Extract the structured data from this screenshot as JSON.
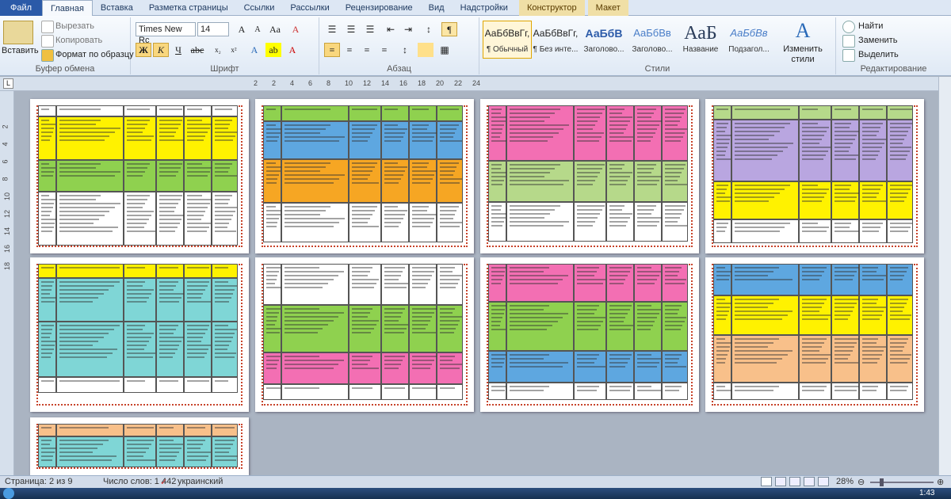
{
  "tabs": [
    "Файл",
    "Главная",
    "Вставка",
    "Разметка страницы",
    "Ссылки",
    "Рассылки",
    "Рецензирование",
    "Вид",
    "Надстройки",
    "Конструктор",
    "Макет"
  ],
  "clipboard": {
    "paste": "Вставить",
    "cut": "Вырезать",
    "copy": "Копировать",
    "format_painter": "Формат по образцу",
    "label": "Буфер обмена"
  },
  "font": {
    "name": "Times New Rc",
    "size": "14",
    "label": "Шрифт",
    "bold": "Ж",
    "italic": "К",
    "underline": "Ч"
  },
  "paragraph": {
    "label": "Абзац"
  },
  "styles": {
    "label": "Стили",
    "items": [
      {
        "sample": "АаБбВвГг,",
        "name": "¶ Обычный"
      },
      {
        "sample": "АаБбВвГг,",
        "name": "¶ Без инте..."
      },
      {
        "sample": "АаБбВ",
        "name": "Заголово..."
      },
      {
        "sample": "АаБбВв",
        "name": "Заголово..."
      },
      {
        "sample": "АаБ",
        "name": "Название"
      },
      {
        "sample": "АаБбВв",
        "name": "Подзагол..."
      }
    ],
    "change": "Изменить стили"
  },
  "editing": {
    "label": "Редактирование",
    "find": "Найти",
    "replace": "Заменить",
    "select": "Выделить"
  },
  "ruler": [
    "2",
    "2",
    "4",
    "6",
    "8",
    "10",
    "12",
    "14",
    "16",
    "18",
    "20",
    "22",
    "24"
  ],
  "vruler": [
    "2",
    "4",
    "6",
    "8",
    "10",
    "12",
    "14",
    "16",
    "18"
  ],
  "status": {
    "page": "Страница: 2 из 9",
    "words": "Число слов: 1 442",
    "lang": "украинский",
    "zoom": "28%"
  },
  "clock": "1:43",
  "colors": {
    "yellow": "#fff200",
    "green": "#8fd14f",
    "pink": "#f36fb3",
    "blue": "#5ea7e0",
    "orange": "#f6a623",
    "lavender": "#b9a6e0",
    "teal": "#7fd6d6",
    "peach": "#f8c08a",
    "lightgreen": "#b6d98a",
    "white": "#ffffff"
  }
}
